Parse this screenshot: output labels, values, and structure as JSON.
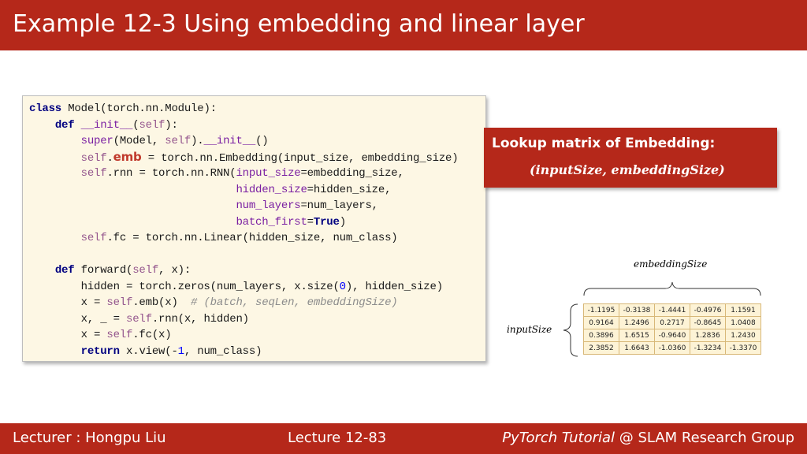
{
  "slide": {
    "title": "Example 12-3 Using embedding and linear layer"
  },
  "code": {
    "lines": [
      "class Model(torch.nn.Module):",
      "    def __init__(self):",
      "        super(Model, self).__init__()",
      "        self.emb = torch.nn.Embedding(input_size, embedding_size)",
      "        self.rnn = torch.nn.RNN(input_size=embedding_size,",
      "                                hidden_size=hidden_size,",
      "                                num_layers=num_layers,",
      "                                batch_first=True)",
      "        self.fc = torch.nn.Linear(hidden_size, num_class)",
      "",
      "    def forward(self, x):",
      "        hidden = torch.zeros(num_layers, x.size(0), hidden_size)",
      "        x = self.emb(x)  # (batch, seqLen, embeddingSize)",
      "        x, _ = self.rnn(x, hidden)",
      "        x = self.fc(x)",
      "        return x.view(-1, num_class)"
    ]
  },
  "callout": {
    "title": "Lookup matrix of Embedding:",
    "formula": "(inputSize, embeddingSize)"
  },
  "matrix": {
    "column_label": "embeddingSize",
    "row_label": "inputSize",
    "rows": [
      [
        "-1.1195",
        "-0.3138",
        "-1.4441",
        "-0.4976",
        "1.1591"
      ],
      [
        "0.9164",
        "1.2496",
        "0.2717",
        "-0.8645",
        "1.0408"
      ],
      [
        "0.3896",
        "1.6515",
        "-0.9640",
        "1.2836",
        "1.2430"
      ],
      [
        "2.3852",
        "1.6643",
        "-1.0360",
        "-1.3234",
        "-1.3370"
      ]
    ]
  },
  "footer": {
    "lecturer": "Lecturer : Hongpu Liu",
    "lecture": "Lecture 12-83",
    "course": "PyTorch Tutorial",
    "group": " @ SLAM Research Group"
  },
  "colors": {
    "brand_red": "#b5281a",
    "code_background": "#fdf7e4",
    "matrix_background": "#fdf3d6"
  }
}
